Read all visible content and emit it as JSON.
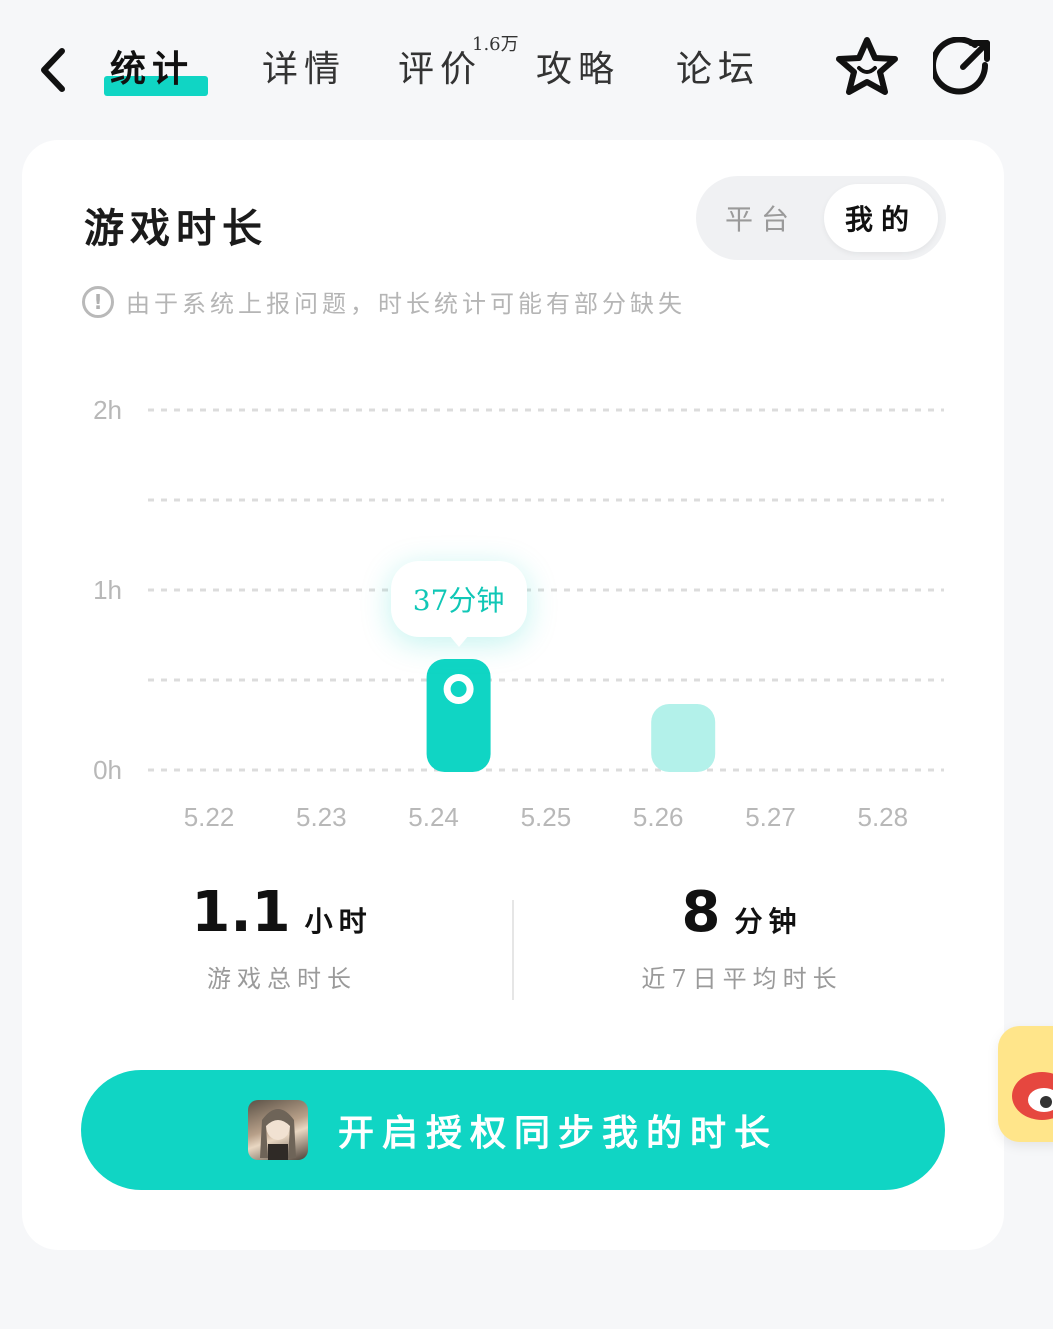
{
  "header": {
    "back_icon": "chevron-left-icon",
    "tabs": [
      {
        "label": "统计",
        "active": true
      },
      {
        "label": "详情",
        "active": false
      },
      {
        "label": "评价",
        "active": false
      },
      {
        "label": "攻略",
        "active": false
      },
      {
        "label": "论坛",
        "active": false
      }
    ],
    "review_count": "1.6万",
    "favorite_icon": "star-face-icon",
    "share_icon": "share-icon"
  },
  "card": {
    "title": "游戏时长",
    "segment": {
      "platform": "平台",
      "mine": "我的",
      "selected": "我的"
    },
    "notice": "由于系统上报问题，时长统计可能有部分缺失"
  },
  "chart_data": {
    "type": "bar",
    "categories": [
      "5.22",
      "5.23",
      "5.24",
      "5.25",
      "5.26",
      "5.27",
      "5.28"
    ],
    "values": [
      0,
      0,
      37,
      0,
      22,
      0,
      0
    ],
    "value_unit": "minutes",
    "y_ticks": [
      "2h",
      "1h",
      "0h"
    ],
    "ylim": [
      0,
      120
    ],
    "highlight_index": 2,
    "tooltip": "37分钟",
    "accent": "#10d5c4",
    "muted": "#b3f1ea",
    "grid": true
  },
  "stats": {
    "total_value": "1.1",
    "total_unit": "小时",
    "total_label": "游戏总时长",
    "avg_value": "8",
    "avg_unit": "分钟",
    "avg_label": "近7日平均时长"
  },
  "cta": {
    "label": "开启授权同步我的时长"
  },
  "colors": {
    "accent": "#10d5c4",
    "background": "#f6f7f9"
  }
}
